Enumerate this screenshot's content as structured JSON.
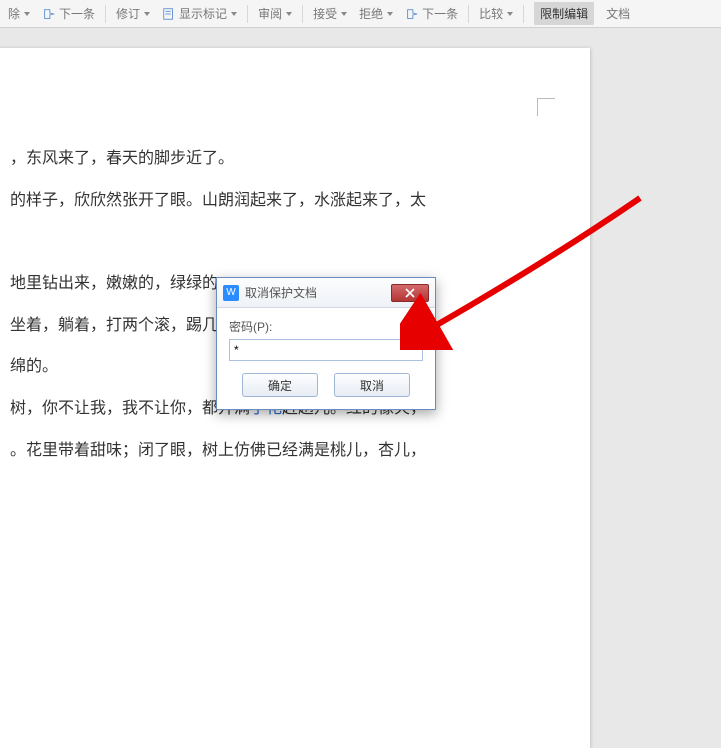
{
  "toolbar": {
    "delete_label": "除",
    "next1_label": "下一条",
    "revise_label": "修订",
    "show_markup_label": "显示标记",
    "review_label": "审阅",
    "accept_label": "接受",
    "reject_label": "拒绝",
    "next2_label": "下一条",
    "compare_label": "比较",
    "restrict_label": "限制编辑",
    "doc_label": "文档"
  },
  "document": {
    "lines": [
      "，东风来了，春天的脚步近了。",
      "的样子，欣欣然张开了眼。山朗润起来了，水涨起来了，太",
      "地里钻出来，嫩嫩的，绿绿的",
      "坐着，躺着，打两个滚，踢几                                藏。",
      "绵的。",
      "树，你不让我，我不让你，都开满",
      "赶趟儿。红的像火，",
      "。花里带着甜味；闭了眼，树上仿佛已经满是桃儿，杏儿，"
    ],
    "link_text": "了花"
  },
  "dialog": {
    "title": "取消保护文档",
    "password_label": "密码(P):",
    "password_value": "*",
    "ok_label": "确定",
    "cancel_label": "取消"
  }
}
